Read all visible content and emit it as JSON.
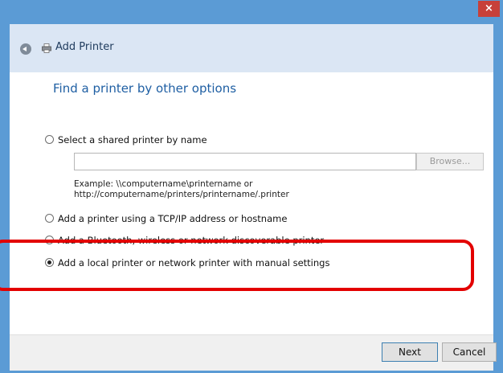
{
  "window": {
    "close_glyph": "×"
  },
  "header": {
    "title": "Add Printer"
  },
  "content": {
    "heading": "Find a printer by other options",
    "options": [
      {
        "label": "Select a shared printer by name",
        "checked": false
      },
      {
        "label": "Add a printer using a TCP/IP address or hostname",
        "checked": false
      },
      {
        "label": "Add a Bluetooth, wireless or network discoverable printer",
        "checked": false
      },
      {
        "label": "Add a local printer or network printer with manual settings",
        "checked": true
      }
    ],
    "shared_printer_input": {
      "value": "",
      "placeholder": ""
    },
    "browse_label": "Browse...",
    "example_line1": "Example: \\\\computername\\printername or",
    "example_line2": "http://computername/printers/printername/.printer"
  },
  "footer": {
    "next_label": "Next",
    "cancel_label": "Cancel"
  },
  "colors": {
    "accent": "#5b9bd5",
    "heading": "#1f5fa3",
    "highlight": "#e30000"
  }
}
